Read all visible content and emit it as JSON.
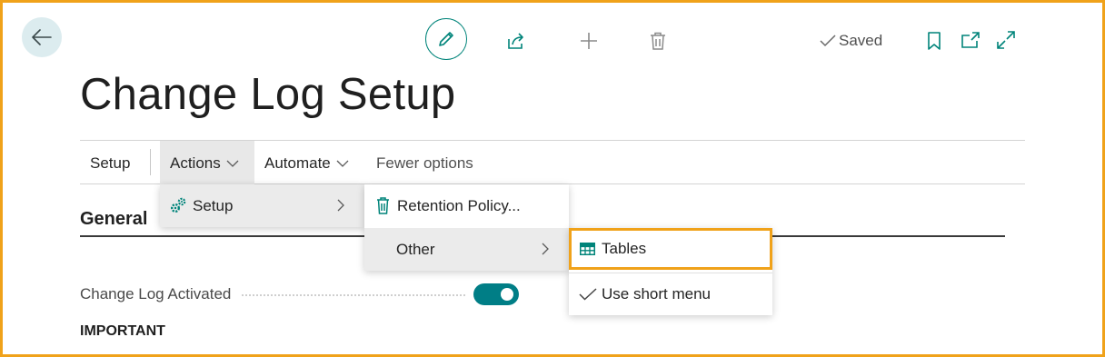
{
  "page": {
    "title": "Change Log Setup",
    "status": "Saved"
  },
  "toolbar": {
    "icons": [
      "back-arrow-icon",
      "edit-pencil-icon",
      "share-icon",
      "add-plus-icon",
      "delete-trash-icon",
      "checkmark-icon",
      "bookmark-icon",
      "open-new-window-icon",
      "expand-icon"
    ]
  },
  "action_bar": {
    "tabs": [
      {
        "label": "Setup"
      },
      {
        "label": "Actions"
      },
      {
        "label": "Automate"
      },
      {
        "label": "Fewer options"
      }
    ]
  },
  "menus": {
    "actions": [
      {
        "label": "Setup",
        "icon": "setup-gears-icon"
      }
    ],
    "setup": [
      {
        "label": "Retention Policy...",
        "icon": "trash-icon"
      },
      {
        "label": "Other"
      }
    ],
    "other": [
      {
        "label": "Tables",
        "icon": "table-grid-icon"
      },
      {
        "label": "Use short menu",
        "icon": "checkmark-icon"
      }
    ]
  },
  "general": {
    "section_title": "General",
    "fields": [
      {
        "label": "Change Log Activated",
        "value": true
      }
    ],
    "important_label": "IMPORTANT"
  },
  "colors": {
    "accent": "#00847a",
    "toggle_on": "#007e86",
    "highlight_outline": "#f0a21a"
  }
}
